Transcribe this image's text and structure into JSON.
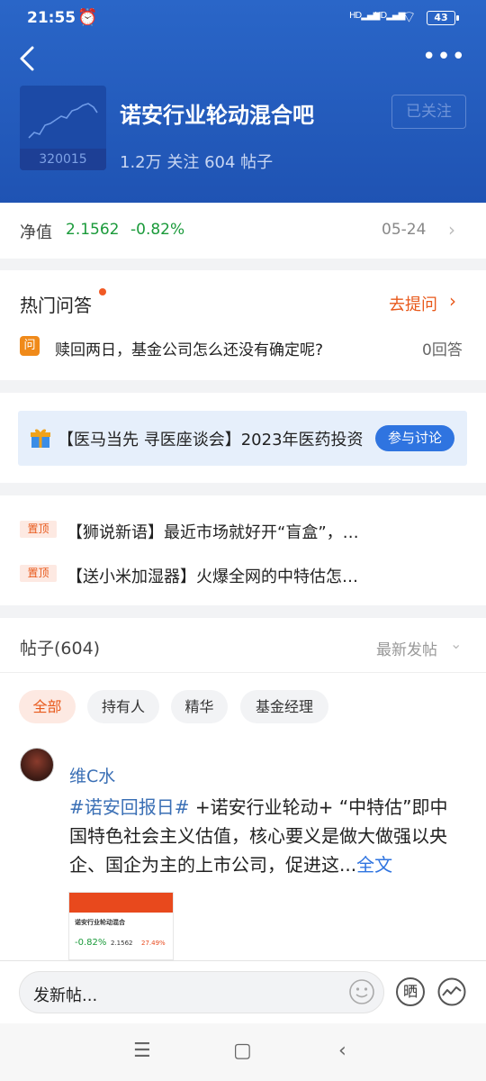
{
  "status_bar": {
    "time": "21:55",
    "signal1": "HD",
    "signal2": "HD",
    "battery": "43"
  },
  "header": {
    "fund_code": "320015",
    "title": "诺安行业轮动混合吧",
    "stats": "1.2万 关注 604 帖子",
    "follow_label": "已关注"
  },
  "nav": {
    "label": "净值",
    "value": "2.1562",
    "change": "-0.82%",
    "date": "05-24"
  },
  "qa": {
    "title": "热门问答",
    "ask_label": "去提问",
    "question_icon": "问",
    "question": "赎回两日，基金公司怎么还没有确定呢?",
    "answer_count": "0回答"
  },
  "banner": {
    "text": "【医马当先 寻医座谈会】2023年医药投资",
    "button": "参与讨论"
  },
  "pinned": [
    {
      "badge": "置顶",
      "text": "【狮说新语】最近市场就好开“盲盒”，…"
    },
    {
      "badge": "置顶",
      "text": "【送小米加湿器】火爆全网的中特估怎…"
    }
  ],
  "posts": {
    "header": "帖子(604)",
    "sort": "最新发帖",
    "filters": [
      "全部",
      "持有人",
      "精华",
      "基金经理"
    ],
    "item": {
      "author": "维C水",
      "tag": "#诺安回报日#",
      "body": " +诺安行业轮动+ “中特估”即中国特色社会主义估值，核心要义是做大做强以央企、国企为主的上市公司，促进这...",
      "full_link": "全文",
      "thumb": {
        "title": "诺安行业轮动混合",
        "v1": "-0.82%",
        "v2": "2.1562",
        "v3": "27.49%"
      }
    }
  },
  "composer": {
    "placeholder": "发新帖...",
    "shai": "晒"
  },
  "colors": {
    "header": "#1f53b3",
    "accent": "#e8591b",
    "up": "#1a9a3a",
    "link": "#2f74e0"
  }
}
